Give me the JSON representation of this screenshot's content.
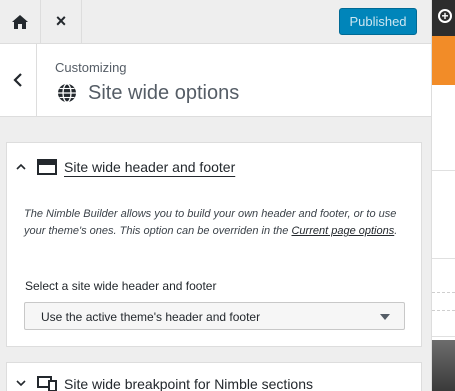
{
  "topbar": {
    "home_icon": "home-icon",
    "close_glyph": "×",
    "publish_label": "Published"
  },
  "section": {
    "customizing_label": "Customizing",
    "icon": "globe-icon",
    "title": "Site wide options"
  },
  "header_footer_panel": {
    "title": "Site wide header and footer",
    "expanded": true,
    "description_text": "The Nimble Builder allows you to build your own header and footer, or to use your theme's ones. This option can be overriden in the ",
    "description_link": "Current page options",
    "description_end": ".",
    "select_label": "Select a site wide header and footer",
    "select_value": "Use the active theme's header and footer"
  },
  "breakpoint_panel": {
    "title": "Site wide breakpoint for Nimble sections",
    "expanded": false
  },
  "colors": {
    "accent": "#0085ba",
    "preview_orange": "#f28c28"
  }
}
